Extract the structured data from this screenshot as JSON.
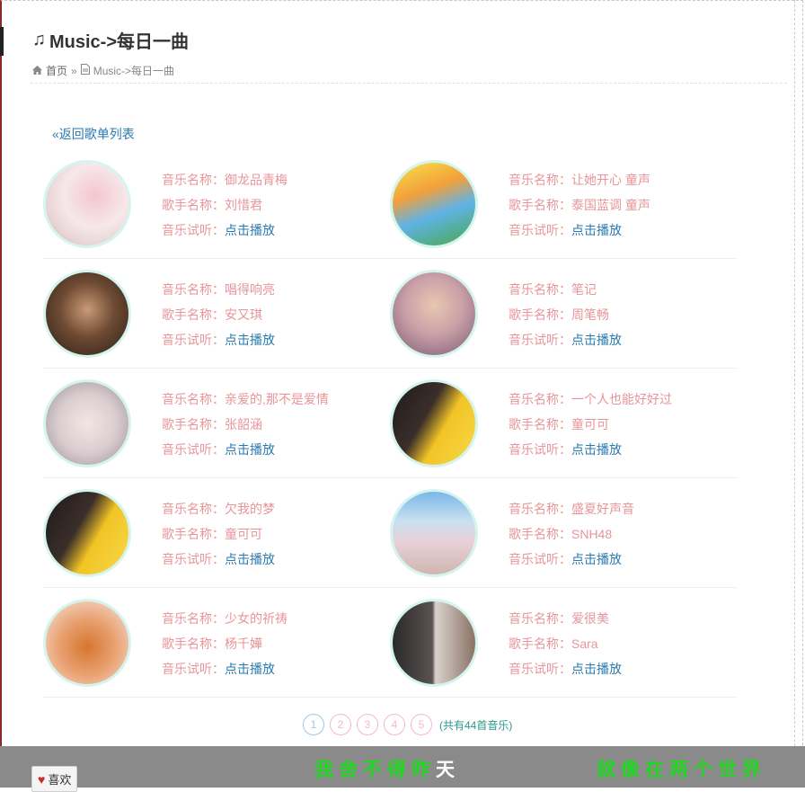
{
  "header": {
    "icon": "music-note-icon",
    "title": "Music->每日一曲",
    "breadcrumb_home": "首页",
    "breadcrumb_sep": "»",
    "breadcrumb_current": "Music->每日一曲"
  },
  "back_link": "«返回歌单列表",
  "labels": {
    "song": "音乐名称：",
    "singer": "歌手名称：",
    "listen": "音乐试听：",
    "play": "点击播放"
  },
  "songs": [
    {
      "song": "御龙品青梅",
      "singer": "刘惜君",
      "cover": "pink-floral-art"
    },
    {
      "song": "让她开心 童声",
      "singer": "泰国蓝调 童声",
      "cover": "cartoon-kids"
    },
    {
      "song": "唱得响亮",
      "singer": "安又琪",
      "cover": "woman-portrait"
    },
    {
      "song": "笔记",
      "singer": "周笔畅",
      "cover": "singer-portrait"
    },
    {
      "song": "亲爱的,那不是爱情",
      "singer": "张韶涵",
      "cover": "singer-headdress"
    },
    {
      "song": "一个人也能好好过",
      "singer": "童可可",
      "cover": "girl-yellow-bg"
    },
    {
      "song": "欠我的梦",
      "singer": "童可可",
      "cover": "girl-yellow-bg"
    },
    {
      "song": "盛夏好声音",
      "singer": "SNH48",
      "cover": "group-photo"
    },
    {
      "song": "少女的祈祷",
      "singer": "杨千嬅",
      "cover": "woman-orange-dress"
    },
    {
      "song": "爱很美",
      "singer": "Sara",
      "cover": "duo-portrait"
    }
  ],
  "pagination": {
    "pages": [
      "1",
      "2",
      "3",
      "4",
      "5"
    ],
    "active": "1",
    "total": "(共有44首音乐)"
  },
  "lyrics": {
    "left_green": "我舍不得昨",
    "left_white": "天",
    "right": "就像在两个世界"
  },
  "like_button": "喜欢",
  "colors": {
    "label": "#e8959a",
    "link": "#2a7ab0",
    "avatar_ring": "#d4f5ee",
    "lyric_green": "#22d622"
  }
}
